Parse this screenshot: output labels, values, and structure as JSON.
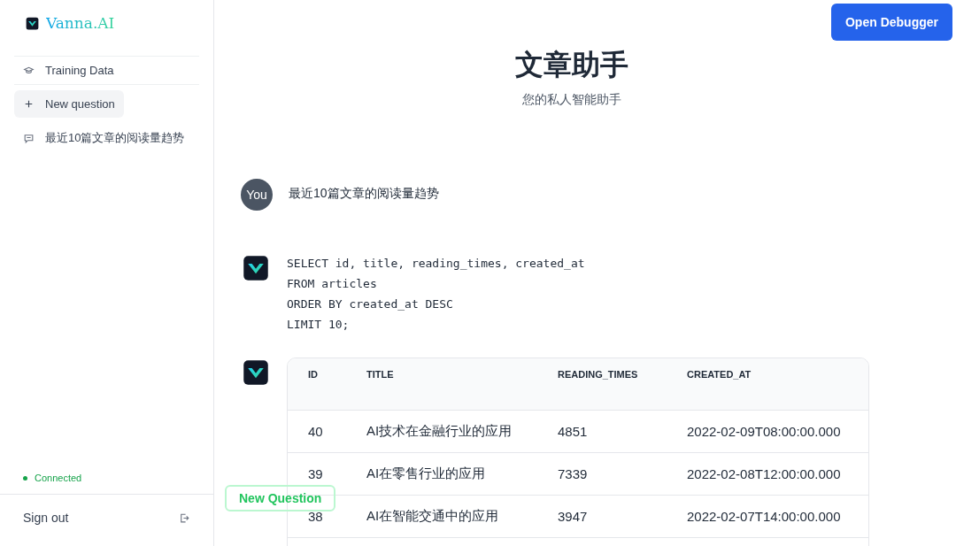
{
  "sidebar": {
    "logo": "Vanna.AI",
    "items": [
      {
        "kind": "training",
        "label": "Training Data",
        "selected": false
      },
      {
        "kind": "new",
        "label": "New question",
        "selected": true
      },
      {
        "kind": "history",
        "label": "最近10篇文章的阅读量趋势",
        "selected": false
      }
    ],
    "status": {
      "label": "Connected",
      "color": "#16a34a"
    },
    "sign_out": "Sign out"
  },
  "header": {
    "button": "Open Debugger",
    "title": "文章助手",
    "subtitle": "您的私人智能助手"
  },
  "messages": [
    {
      "kind": "user",
      "avatar": "You",
      "text": "最近10篇文章的阅读量趋势"
    },
    {
      "kind": "sql",
      "lines": [
        "SELECT id, title, reading_times, created_at",
        "FROM articles",
        "ORDER BY created_at DESC",
        "LIMIT 10;"
      ]
    },
    {
      "kind": "table",
      "columns": [
        "ID",
        "TITLE",
        "READING_TIMES",
        "CREATED_AT"
      ],
      "rows": [
        [
          "40",
          "AI技术在金融行业的应用",
          "4851",
          "2022-02-09T08:00:00.000"
        ],
        [
          "39",
          "AI在零售行业的应用",
          "7339",
          "2022-02-08T12:00:00.000"
        ],
        [
          "38",
          "AI在智能交通中的应用",
          "3947",
          "2022-02-07T14:00:00.000"
        ]
      ]
    }
  ],
  "floating_button": "New Question"
}
